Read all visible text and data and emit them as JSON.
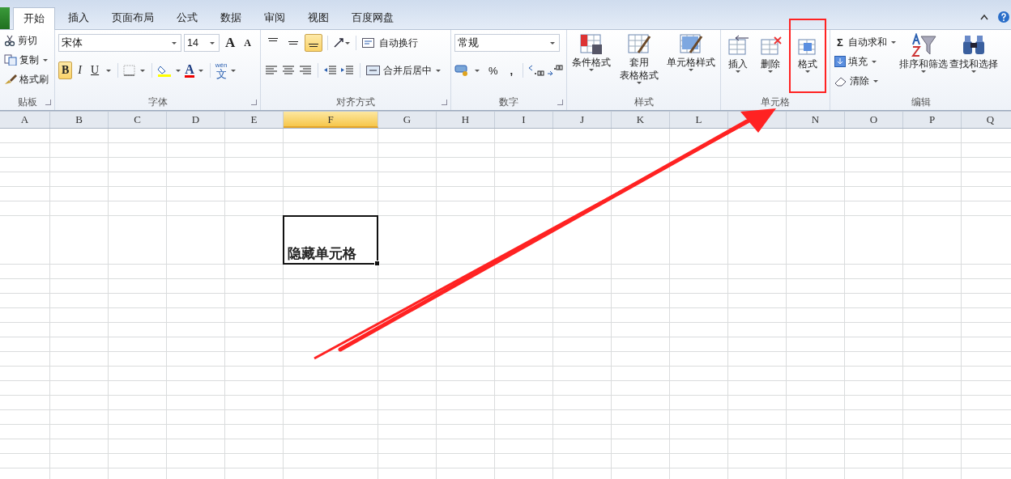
{
  "tabs": [
    {
      "label": "开始",
      "selected": true
    },
    {
      "label": "插入",
      "selected": false
    },
    {
      "label": "页面布局",
      "selected": false
    },
    {
      "label": "公式",
      "selected": false
    },
    {
      "label": "数据",
      "selected": false
    },
    {
      "label": "审阅",
      "selected": false
    },
    {
      "label": "视图",
      "selected": false
    },
    {
      "label": "百度网盘",
      "selected": false
    }
  ],
  "clipboard": {
    "label": "贴板",
    "items": [
      {
        "label": "剪切",
        "dropdown": false
      },
      {
        "label": "复制",
        "dropdown": true
      },
      {
        "label": "格式刷",
        "dropdown": false
      }
    ]
  },
  "font": {
    "label": "字体",
    "name": "宋体",
    "size": "14",
    "grow": "A",
    "shrink": "A",
    "styles": [
      {
        "label": "B",
        "selected": true
      },
      {
        "label": "I",
        "selected": false
      },
      {
        "label": "U",
        "selected": false
      }
    ],
    "color_letter": "A",
    "phonetic_top": "wén",
    "phonetic": "文"
  },
  "alignment": {
    "label": "对齐方式",
    "vertical": [
      {
        "selected": false
      },
      {
        "selected": false
      },
      {
        "selected": true
      }
    ],
    "wrap": "自动换行",
    "merge": "合并后居中"
  },
  "number": {
    "label": "数字",
    "format": "常规",
    "percent": "%",
    "comma": ","
  },
  "styles": {
    "label": "样式",
    "items": [
      {
        "lines": [
          "条件格式"
        ]
      },
      {
        "lines": [
          "套用",
          "表格格式"
        ]
      },
      {
        "lines": [
          "单元格样式"
        ]
      }
    ]
  },
  "cells": {
    "label": "单元格",
    "items": [
      {
        "label": "插入",
        "highlighted": false
      },
      {
        "label": "删除",
        "highlighted": false
      },
      {
        "label": "格式",
        "highlighted": true
      }
    ]
  },
  "editing": {
    "label": "编辑",
    "sigma": "Σ",
    "small": [
      {
        "label": "自动求和"
      },
      {
        "label": "填充"
      },
      {
        "label": "清除"
      }
    ],
    "large": [
      {
        "label": "排序和筛选"
      },
      {
        "label": "查找和选择"
      }
    ]
  },
  "sheet": {
    "columns": [
      {
        "label": "A",
        "selected": false
      },
      {
        "label": "B",
        "selected": false
      },
      {
        "label": "C",
        "selected": false
      },
      {
        "label": "D",
        "selected": false
      },
      {
        "label": "E",
        "selected": false
      },
      {
        "label": "F",
        "selected": true
      },
      {
        "label": "G",
        "selected": false
      },
      {
        "label": "H",
        "selected": false
      },
      {
        "label": "I",
        "selected": false
      },
      {
        "label": "J",
        "selected": false
      },
      {
        "label": "K",
        "selected": false
      },
      {
        "label": "L",
        "selected": false
      },
      {},
      {
        "label": "N",
        "selected": false
      },
      {
        "label": "O",
        "selected": false
      },
      {
        "label": "P",
        "selected": false
      },
      {
        "label": "Q",
        "selected": false
      }
    ],
    "active_cell": {
      "text": "隐藏单元格"
    }
  }
}
